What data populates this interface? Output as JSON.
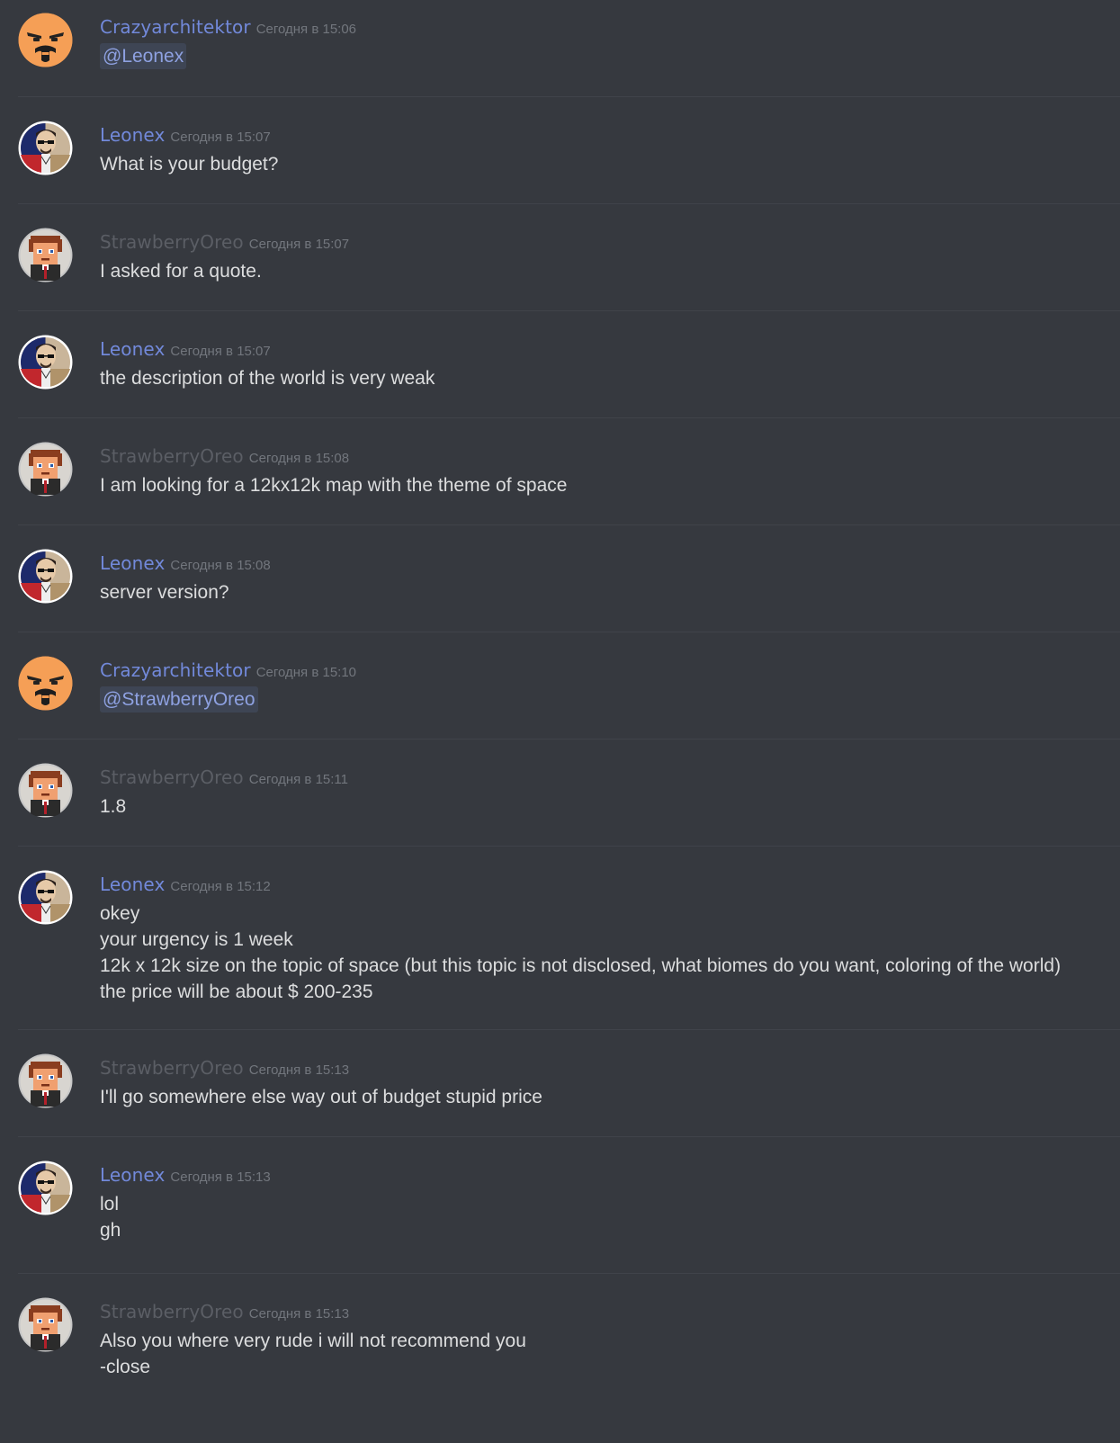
{
  "colors": {
    "background": "#36393f",
    "divider": "#40434a",
    "author_blue": "#7289da",
    "author_gray": "#5b5e65",
    "timestamp": "#72767d",
    "text": "#dcddde",
    "mention_bg": "#3e4554",
    "mention_text": "#8ea1e1"
  },
  "messages": [
    {
      "author": "Crazyarchitektor",
      "timestamp": "Сегодня в 15:06",
      "avatar": "crazyarchitektor-avatar",
      "lines": [
        "@Leonex"
      ]
    },
    {
      "author": "Leonex",
      "timestamp": "Сегодня в 15:07",
      "avatar": "leonex-avatar",
      "lines": [
        "What is your budget?"
      ]
    },
    {
      "author": "StrawberryOreo",
      "timestamp": "Сегодня в 15:07",
      "avatar": "strawberryoreo-avatar",
      "lines": [
        "I asked for a quote."
      ]
    },
    {
      "author": "Leonex",
      "timestamp": "Сегодня в 15:07",
      "avatar": "leonex-avatar",
      "lines": [
        "the description of the world is very weak"
      ]
    },
    {
      "author": "StrawberryOreo",
      "timestamp": "Сегодня в 15:08",
      "avatar": "strawberryoreo-avatar",
      "lines": [
        "I am looking for a 12kx12k map with the theme of space"
      ]
    },
    {
      "author": "Leonex",
      "timestamp": "Сегодня в 15:08",
      "avatar": "leonex-avatar",
      "lines": [
        "server version?"
      ]
    },
    {
      "author": "Crazyarchitektor",
      "timestamp": "Сегодня в 15:10",
      "avatar": "crazyarchitektor-avatar",
      "lines": [
        "@StrawberryOreo"
      ]
    },
    {
      "author": "StrawberryOreo",
      "timestamp": "Сегодня в 15:11",
      "avatar": "strawberryoreo-avatar",
      "lines": [
        "1.8"
      ]
    },
    {
      "author": "Leonex",
      "timestamp": "Сегодня в 15:12",
      "avatar": "leonex-avatar",
      "lines": [
        "okey",
        "your urgency is 1 week",
        "12k x 12k size on the topic of space (but this topic is not disclosed, what biomes do you want, coloring of the world)",
        "the price will be about $ 200-235"
      ]
    },
    {
      "author": "StrawberryOreo",
      "timestamp": "Сегодня в 15:13",
      "avatar": "strawberryoreo-avatar",
      "lines": [
        "I'll go somewhere else way out of budget stupid price"
      ]
    },
    {
      "author": "Leonex",
      "timestamp": "Сегодня в 15:13",
      "avatar": "leonex-avatar",
      "lines": [
        "lol",
        "gh"
      ]
    },
    {
      "author": "StrawberryOreo",
      "timestamp": "Сегодня в 15:13",
      "avatar": "strawberryoreo-avatar",
      "lines": [
        "Also you where very rude i will not recommend you",
        "-close"
      ]
    }
  ]
}
